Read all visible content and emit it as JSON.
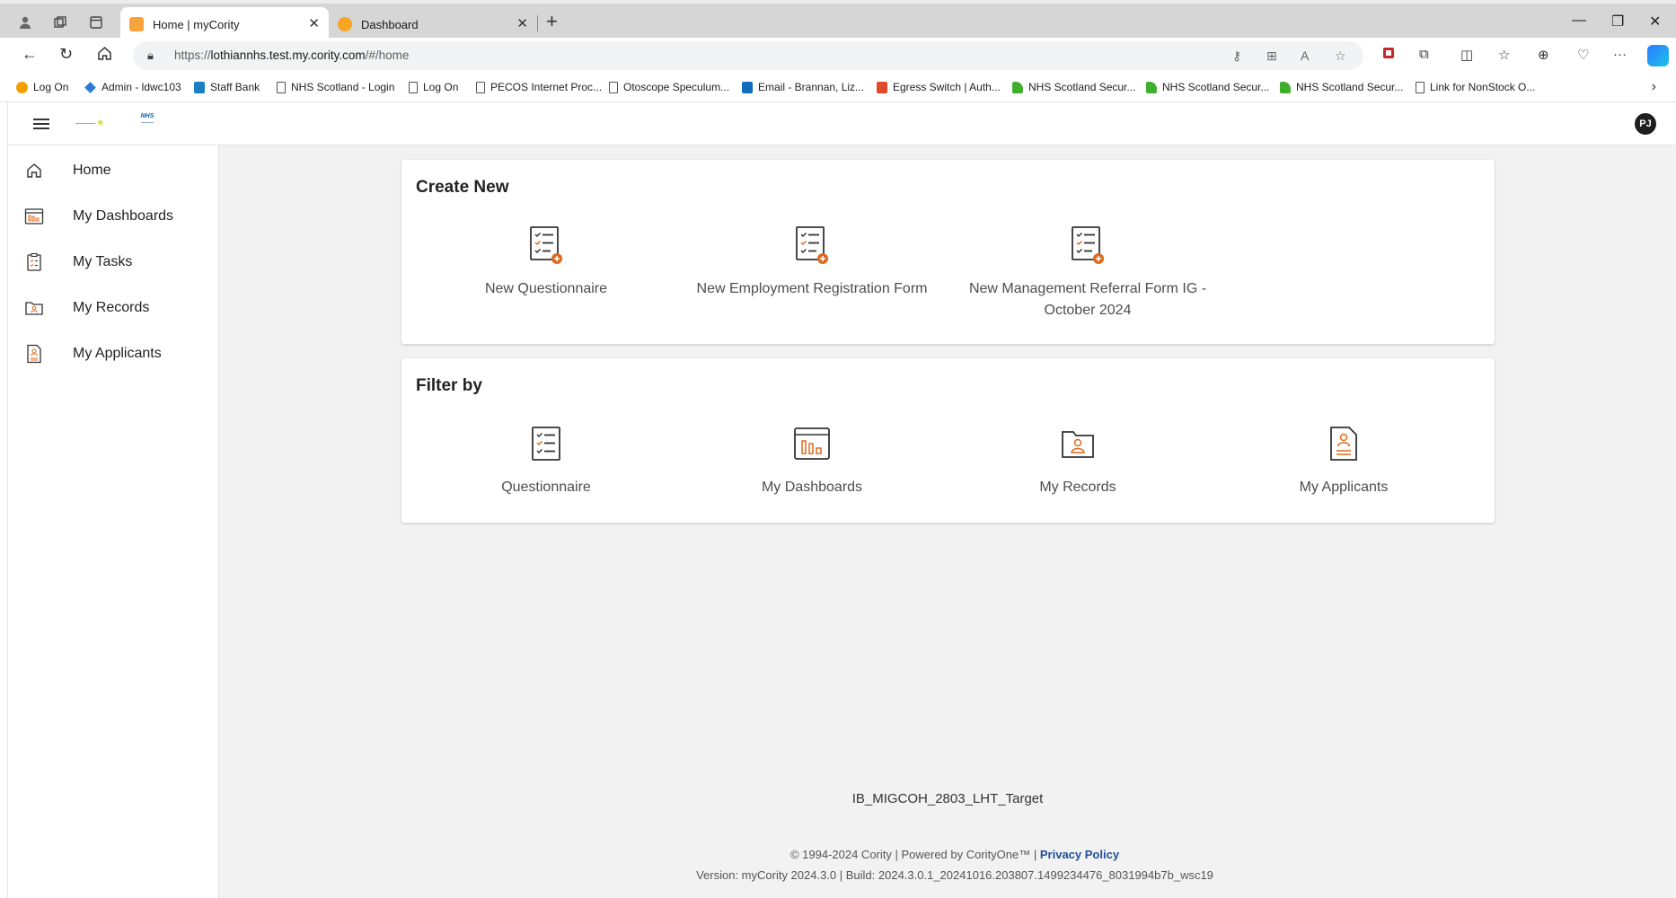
{
  "browser": {
    "tabs": [
      {
        "title": "Home | myCority",
        "favicon": "cority-icon",
        "active": true
      },
      {
        "title": "Dashboard",
        "favicon": "orange-circle-icon",
        "active": false
      }
    ],
    "url": {
      "prefix": "https://",
      "host": "lothiannhs.test.my.cority.com",
      "path": "/#/home"
    },
    "bookmarks": [
      {
        "label": "Log On",
        "icon": "orange-circle-icon"
      },
      {
        "label": "Admin - ldwc103",
        "icon": "diamond-icon"
      },
      {
        "label": "Staff Bank",
        "icon": "sharepoint-icon"
      },
      {
        "label": "NHS Scotland - Login",
        "icon": "page-icon"
      },
      {
        "label": "Log On",
        "icon": "page-icon"
      },
      {
        "label": "PECOS Internet Proc...",
        "icon": "page-icon"
      },
      {
        "label": "Otoscope Speculum...",
        "icon": "page-icon"
      },
      {
        "label": "Email - Brannan, Liz...",
        "icon": "outlook-icon"
      },
      {
        "label": "Egress Switch | Auth...",
        "icon": "egress-icon"
      },
      {
        "label": "NHS Scotland Secur...",
        "icon": "nhs-icon"
      },
      {
        "label": "NHS Scotland Secur...",
        "icon": "nhs-icon"
      },
      {
        "label": "NHS Scotland Secur...",
        "icon": "nhs-icon"
      },
      {
        "label": "Link for NonStock O...",
        "icon": "page-icon"
      }
    ]
  },
  "header": {
    "avatar_initials": "PJ"
  },
  "sidebar": {
    "items": [
      {
        "label": "Home",
        "icon": "home-icon"
      },
      {
        "label": "My Dashboards",
        "icon": "dashboard-icon"
      },
      {
        "label": "My Tasks",
        "icon": "clipboard-icon"
      },
      {
        "label": "My Records",
        "icon": "records-icon"
      },
      {
        "label": "My Applicants",
        "icon": "applicant-icon"
      }
    ]
  },
  "create_new": {
    "title": "Create New",
    "items": [
      {
        "label": "New Questionnaire",
        "icon": "questionnaire-add-icon"
      },
      {
        "label": "New Employment Registration Form",
        "icon": "questionnaire-add-icon"
      },
      {
        "label_line1": "New Management Referral Form IG -",
        "label_line2": "October 2024",
        "icon": "questionnaire-add-icon"
      }
    ]
  },
  "filter_by": {
    "title": "Filter by",
    "items": [
      {
        "label": "Questionnaire",
        "icon": "questionnaire-icon"
      },
      {
        "label": "My Dashboards",
        "icon": "dashboard-icon"
      },
      {
        "label": "My Records",
        "icon": "records-icon"
      },
      {
        "label": "My Applicants",
        "icon": "applicant-icon"
      }
    ]
  },
  "footer": {
    "target": "IB_MIGCOH_2803_LHT_Target",
    "copyright": "© 1994-2024 Cority | Powered by CorityOne™ |",
    "privacy": "Privacy Policy",
    "version": "Version: myCority 2024.3.0 | Build: 2024.3.0.1_20241016.203807.1499234476_8031994b7b_wsc19"
  },
  "colors": {
    "accent": "#e06a1b",
    "icon_dark": "#333333",
    "link": "#1f4f9a"
  }
}
